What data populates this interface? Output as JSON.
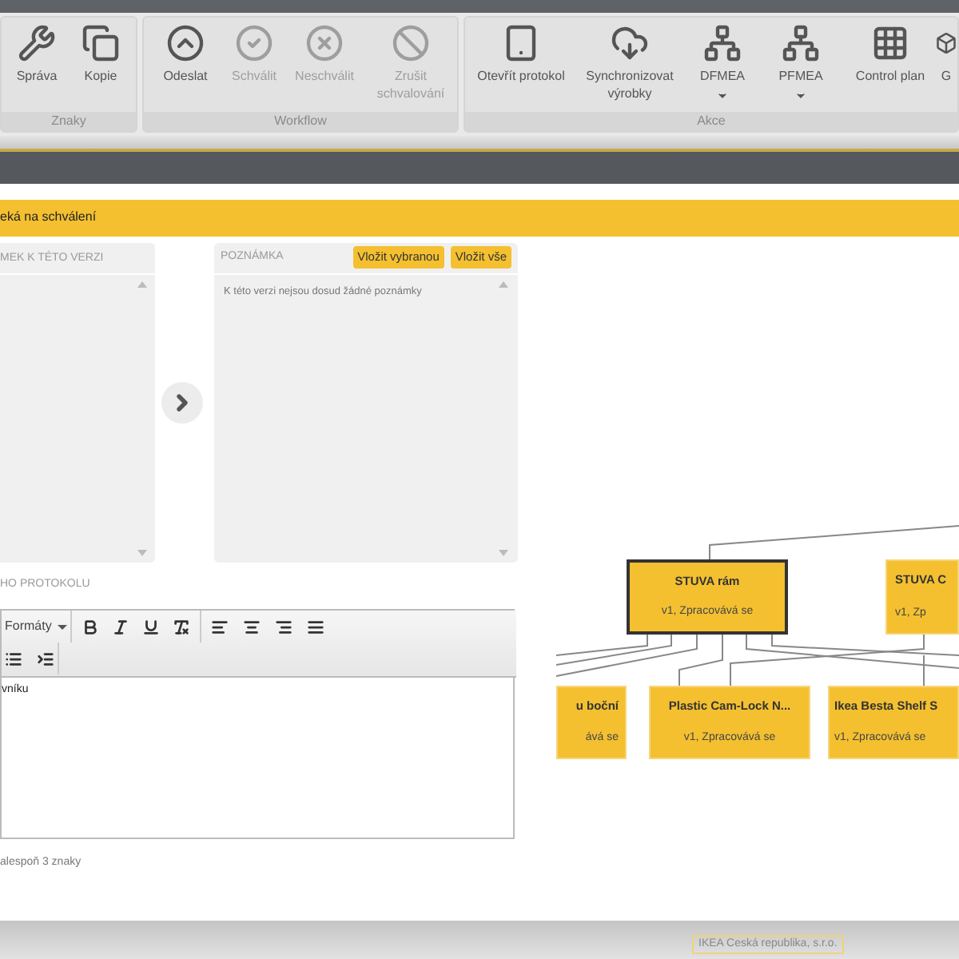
{
  "toolbar": {
    "groups": [
      {
        "label": "Znaky",
        "buttons": [
          {
            "label": "Správa",
            "disabled": false
          },
          {
            "label": "Kopie",
            "disabled": false
          }
        ]
      },
      {
        "label": "Workflow",
        "buttons": [
          {
            "label": "Odeslat",
            "disabled": false
          },
          {
            "label": "Schválit",
            "disabled": true
          },
          {
            "label": "Neschválit",
            "disabled": true
          },
          {
            "label": "Zrušit schvalování",
            "disabled": true
          }
        ]
      },
      {
        "label": "Akce",
        "buttons": [
          {
            "label": "Otevřít protokol",
            "disabled": false
          },
          {
            "label": "Synchronizovat výrobky",
            "disabled": false
          },
          {
            "label": "DFMEA",
            "disabled": false,
            "dropdown": true
          },
          {
            "label": "PFMEA",
            "disabled": false,
            "dropdown": true
          },
          {
            "label": "Control plan",
            "disabled": false
          },
          {
            "label": "G",
            "disabled": false
          }
        ]
      }
    ]
  },
  "status_bar": {
    "text": "eká na schválení"
  },
  "left_panel": {
    "title": "MEK K TÉTO VERZI"
  },
  "notes_panel": {
    "title": "POZNÁMKA",
    "buttons": [
      "Vložit vybranou",
      "Vložit vše"
    ],
    "empty_text": "K této verzi nejsou dosud žádné poznámky"
  },
  "protocol_label": "HO PROTOKOLU",
  "editor": {
    "formats": "Formáty",
    "value": "vníku"
  },
  "hint": "alespoň 3 znaky",
  "diagram": {
    "nodes": [
      {
        "title": "STUVA rám",
        "subtitle": "v1, Zpracovává se",
        "selected": true
      },
      {
        "title": "STUVA C",
        "subtitle": "v1, Zp",
        "selected": false
      },
      {
        "title": "u boční",
        "subtitle": "ává se",
        "selected": false
      },
      {
        "title": "Plastic Cam-Lock N...",
        "subtitle": "v1, Zpracovává se",
        "selected": false
      },
      {
        "title": "Ikea Besta Shelf S",
        "subtitle": "v1, Zpracovává se",
        "selected": false
      }
    ]
  },
  "footer": "IKEA Ceská republika, s.r.o."
}
